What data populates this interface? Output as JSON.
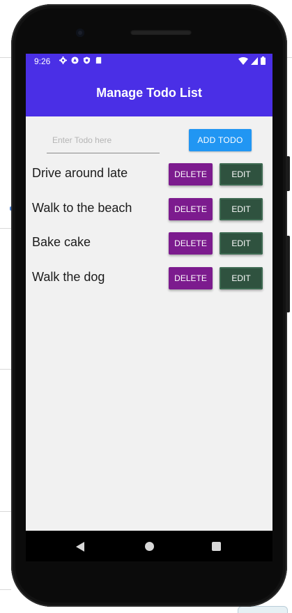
{
  "status_bar": {
    "time": "9:26",
    "left_icons": [
      "settings-icon",
      "android-icon",
      "shield-icon",
      "sd-card-icon"
    ],
    "right_icons": [
      "wifi-icon",
      "signal-icon",
      "battery-icon"
    ]
  },
  "app_bar": {
    "title": "Manage Todo List"
  },
  "new_todo": {
    "placeholder": "Enter Todo here",
    "value": "",
    "add_label": "ADD TODO"
  },
  "todos": [
    {
      "text": "Drive around late",
      "delete_label": "DELETE",
      "edit_label": "EDIT"
    },
    {
      "text": "Walk to the beach",
      "delete_label": "DELETE",
      "edit_label": "EDIT"
    },
    {
      "text": "Bake cake",
      "delete_label": "DELETE",
      "edit_label": "EDIT"
    },
    {
      "text": "Walk the dog",
      "delete_label": "DELETE",
      "edit_label": "EDIT"
    }
  ],
  "nav_bar": {
    "icons": [
      "back-icon",
      "home-icon",
      "recent-apps-icon"
    ]
  },
  "colors": {
    "app_bar": "#4a2fe6",
    "add_button": "#2196f3",
    "delete_button": "#7c1b8e",
    "edit_button": "#2f523f",
    "screen_background": "#f1f1f1"
  }
}
